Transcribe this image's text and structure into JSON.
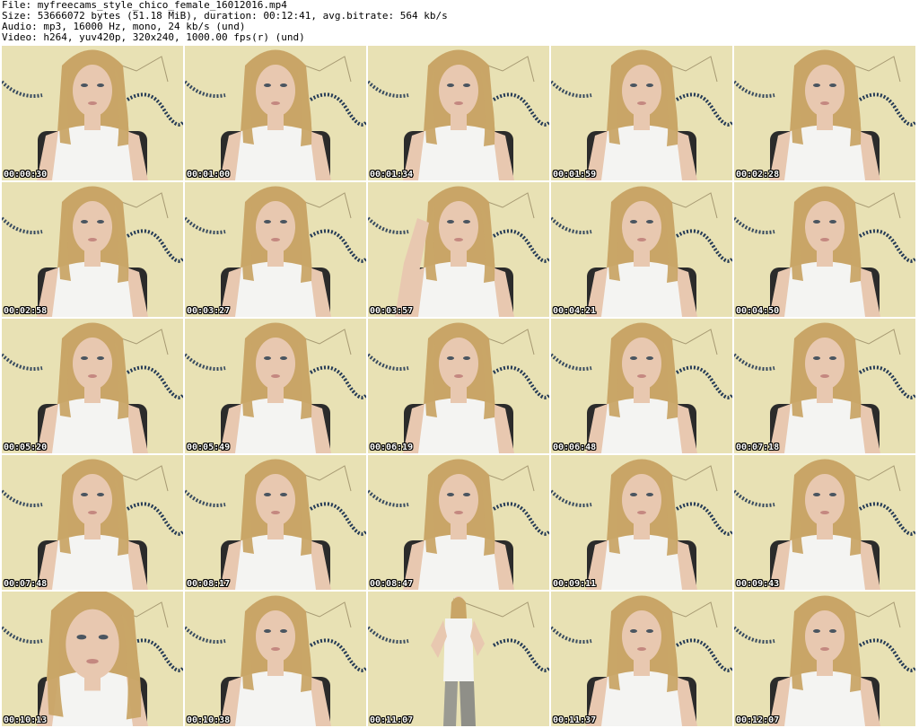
{
  "header": {
    "file_line": "File: myfreecams_style_chico_female_16012016.mp4",
    "size_line": "Size: 53666072 bytes (51.18 MiB), duration: 00:12:41, avg.bitrate: 564 kb/s",
    "audio_line": "Audio: mp3, 16000 Hz, mono, 24 kb/s (und)",
    "video_line": "Video: h264, yuv420p, 320x240, 1000.00 fps(r) (und)"
  },
  "thumbnails": [
    {
      "timestamp": "00:00:30",
      "pose": "seated"
    },
    {
      "timestamp": "00:01:00",
      "pose": "seated"
    },
    {
      "timestamp": "00:01:34",
      "pose": "seated"
    },
    {
      "timestamp": "00:01:59",
      "pose": "seated"
    },
    {
      "timestamp": "00:02:28",
      "pose": "seated"
    },
    {
      "timestamp": "00:02:58",
      "pose": "seated"
    },
    {
      "timestamp": "00:03:27",
      "pose": "seated"
    },
    {
      "timestamp": "00:03:57",
      "pose": "hand-raised"
    },
    {
      "timestamp": "00:04:21",
      "pose": "seated"
    },
    {
      "timestamp": "00:04:50",
      "pose": "seated"
    },
    {
      "timestamp": "00:05:20",
      "pose": "seated"
    },
    {
      "timestamp": "00:05:49",
      "pose": "seated"
    },
    {
      "timestamp": "00:06:19",
      "pose": "seated"
    },
    {
      "timestamp": "00:06:48",
      "pose": "seated"
    },
    {
      "timestamp": "00:07:18",
      "pose": "seated"
    },
    {
      "timestamp": "00:07:48",
      "pose": "seated"
    },
    {
      "timestamp": "00:08:17",
      "pose": "seated"
    },
    {
      "timestamp": "00:08:47",
      "pose": "seated"
    },
    {
      "timestamp": "00:09:11",
      "pose": "seated"
    },
    {
      "timestamp": "00:09:43",
      "pose": "seated"
    },
    {
      "timestamp": "00:10:13",
      "pose": "close-up"
    },
    {
      "timestamp": "00:10:38",
      "pose": "seated"
    },
    {
      "timestamp": "00:11:07",
      "pose": "standing"
    },
    {
      "timestamp": "00:11:37",
      "pose": "seated"
    },
    {
      "timestamp": "00:12:07",
      "pose": "seated"
    }
  ],
  "colors": {
    "wall": "#e6dfae",
    "hair": "#c9a567",
    "skin": "#e8c8b0",
    "shirt": "#f4f4f2",
    "chair": "#2b2b2b",
    "garland": "#243a55",
    "timestamp_text": "#ffffff"
  }
}
